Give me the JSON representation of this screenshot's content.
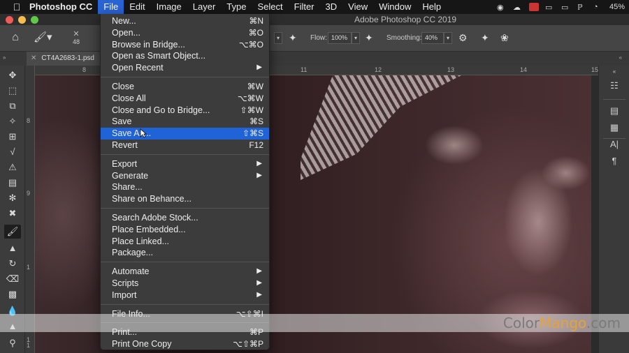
{
  "menubar": {
    "app_name": "Photoshop CC",
    "items": [
      "File",
      "Edit",
      "Image",
      "Layer",
      "Type",
      "Select",
      "Filter",
      "3D",
      "View",
      "Window",
      "Help"
    ],
    "battery": "45%"
  },
  "window": {
    "title": "Adobe Photoshop CC 2019"
  },
  "options_bar": {
    "brush_size": "48",
    "flow_label": "Flow:",
    "flow_value": "100%",
    "smoothing_label": "Smoothing:",
    "smoothing_value": "40%"
  },
  "document": {
    "tab_name": "CT4A2683-1.psd"
  },
  "rulers": {
    "top": [
      "8",
      "11",
      "12",
      "13",
      "14",
      "15"
    ],
    "left": [
      "8",
      "9",
      "1",
      "1",
      "1"
    ]
  },
  "file_menu": {
    "groups": [
      [
        {
          "label": "New...",
          "shortcut": "⌘N"
        },
        {
          "label": "Open...",
          "shortcut": "⌘O"
        },
        {
          "label": "Browse in Bridge...",
          "shortcut": "⌥⌘O"
        },
        {
          "label": "Open as Smart Object...",
          "shortcut": ""
        },
        {
          "label": "Open Recent",
          "submenu": true
        }
      ],
      [
        {
          "label": "Close",
          "shortcut": "⌘W"
        },
        {
          "label": "Close All",
          "shortcut": "⌥⌘W"
        },
        {
          "label": "Close and Go to Bridge...",
          "shortcut": "⇧⌘W"
        },
        {
          "label": "Save",
          "shortcut": "⌘S"
        },
        {
          "label": "Save As...",
          "shortcut": "⇧⌘S",
          "highlighted": true
        },
        {
          "label": "Revert",
          "shortcut": "F12"
        }
      ],
      [
        {
          "label": "Export",
          "submenu": true
        },
        {
          "label": "Generate",
          "submenu": true
        },
        {
          "label": "Share...",
          "shortcut": ""
        },
        {
          "label": "Share on Behance...",
          "shortcut": ""
        }
      ],
      [
        {
          "label": "Search Adobe Stock...",
          "shortcut": ""
        },
        {
          "label": "Place Embedded...",
          "shortcut": ""
        },
        {
          "label": "Place Linked...",
          "shortcut": ""
        },
        {
          "label": "Package...",
          "shortcut": ""
        }
      ],
      [
        {
          "label": "Automate",
          "submenu": true
        },
        {
          "label": "Scripts",
          "submenu": true
        },
        {
          "label": "Import",
          "submenu": true
        }
      ],
      [
        {
          "label": "File Info...",
          "shortcut": "⌥⇧⌘I"
        }
      ],
      [
        {
          "label": "Print...",
          "shortcut": "⌘P"
        },
        {
          "label": "Print One Copy",
          "shortcut": "⌥⇧⌘P"
        }
      ]
    ]
  },
  "watermark": {
    "prefix": "Color",
    "accent": "Mango",
    "suffix": ".com"
  },
  "colors": {
    "menu_highlight": "#1f63d6",
    "menu_bg": "#3c3c3c",
    "ui_dark": "#2b2b2b"
  }
}
